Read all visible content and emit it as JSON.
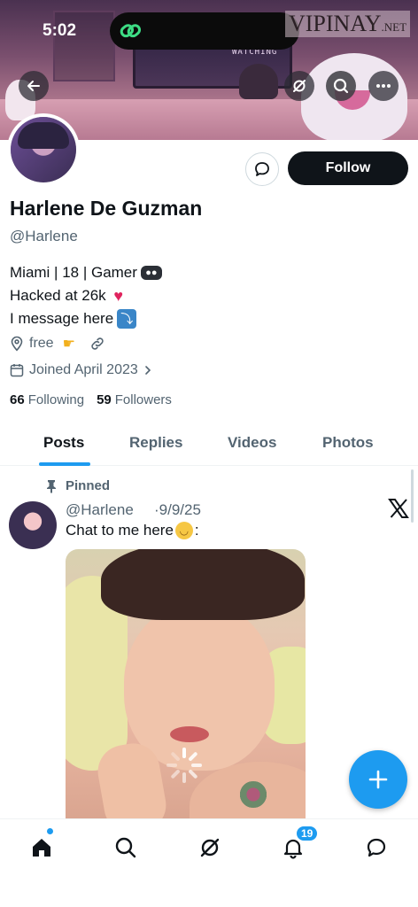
{
  "status_bar": {
    "time": "5:02"
  },
  "watermark": {
    "main": "VIPINAY",
    "suffix": ".NET"
  },
  "banner": {
    "monitor_text": "WATCHING"
  },
  "profile": {
    "display_name": "Harlene De Guzman",
    "handle": "@Harlene",
    "follow_label": "Follow",
    "bio_lines": [
      "Miami | 18 | Gamer",
      "Hacked at 26k",
      "I message here"
    ],
    "location": "free",
    "joined": "Joined April 2023",
    "following_count": "66",
    "following_label": "Following",
    "followers_count": "59",
    "followers_label": "Followers"
  },
  "tabs": [
    "Posts",
    "Replies",
    "Videos",
    "Photos"
  ],
  "active_tab": "Posts",
  "post": {
    "pinned_label": "Pinned",
    "handle": "@Harlene",
    "date": "·9/9/25",
    "text": "Chat to me here",
    "text_suffix": ":"
  },
  "nav": {
    "notifications_badge": "19"
  },
  "colors": {
    "accent": "#1d9bf0",
    "text": "#0f1419",
    "muted": "#536471",
    "follow_bg": "#0f1419"
  },
  "icons": {
    "back": "arrow-left-icon",
    "grok": "grok-icon",
    "search": "search-icon",
    "more": "more-horizontal-icon",
    "message": "message-bubble-icon",
    "location": "location-pin-icon",
    "link": "link-icon",
    "calendar": "calendar-icon",
    "pin": "pin-icon",
    "x": "x-logo-icon",
    "compose": "plus-icon",
    "home": "home-icon",
    "notifications": "bell-icon",
    "messages": "chat-bubble-icon"
  }
}
